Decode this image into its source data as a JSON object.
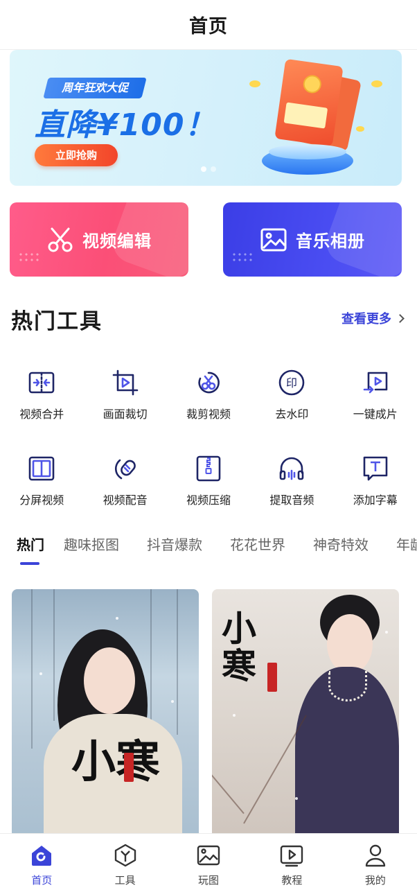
{
  "header": {
    "title": "首页"
  },
  "banner": {
    "tag": "周年狂欢大促",
    "headline": "直降¥100！",
    "button": "立即抢购"
  },
  "features": [
    {
      "label": "视频编辑",
      "icon": "scissors-icon"
    },
    {
      "label": "音乐相册",
      "icon": "image-icon"
    }
  ],
  "hot_tools": {
    "title": "热门工具",
    "more": "查看更多",
    "items": [
      {
        "label": "视频合并",
        "icon": "merge-icon"
      },
      {
        "label": "画面裁切",
        "icon": "crop-icon"
      },
      {
        "label": "裁剪视频",
        "icon": "cut-video-icon"
      },
      {
        "label": "去水印",
        "icon": "watermark-icon"
      },
      {
        "label": "一键成片",
        "icon": "one-click-icon"
      },
      {
        "label": "分屏视频",
        "icon": "split-screen-icon"
      },
      {
        "label": "视频配音",
        "icon": "microphone-icon"
      },
      {
        "label": "视频压缩",
        "icon": "compress-icon"
      },
      {
        "label": "提取音频",
        "icon": "headphones-icon"
      },
      {
        "label": "添加字幕",
        "icon": "subtitle-icon"
      }
    ]
  },
  "categories": {
    "active": "热门",
    "items": [
      "热门",
      "趣味抠图",
      "抖音爆款",
      "花花世界",
      "神奇特效",
      "年龄"
    ]
  },
  "templates": [
    {
      "text": "小寒"
    },
    {
      "text": "小寒"
    }
  ],
  "tabbar": {
    "active": "首页",
    "items": [
      {
        "label": "首页",
        "icon": "home-icon"
      },
      {
        "label": "工具",
        "icon": "tools-icon"
      },
      {
        "label": "玩图",
        "icon": "picture-icon"
      },
      {
        "label": "教程",
        "icon": "tutorial-icon"
      },
      {
        "label": "我的",
        "icon": "profile-icon"
      }
    ]
  },
  "colors": {
    "accent": "#3b44d8",
    "video_card": "#fb4f77",
    "music_card": "#4a4df2",
    "banner_headline": "#1b6fe6"
  }
}
